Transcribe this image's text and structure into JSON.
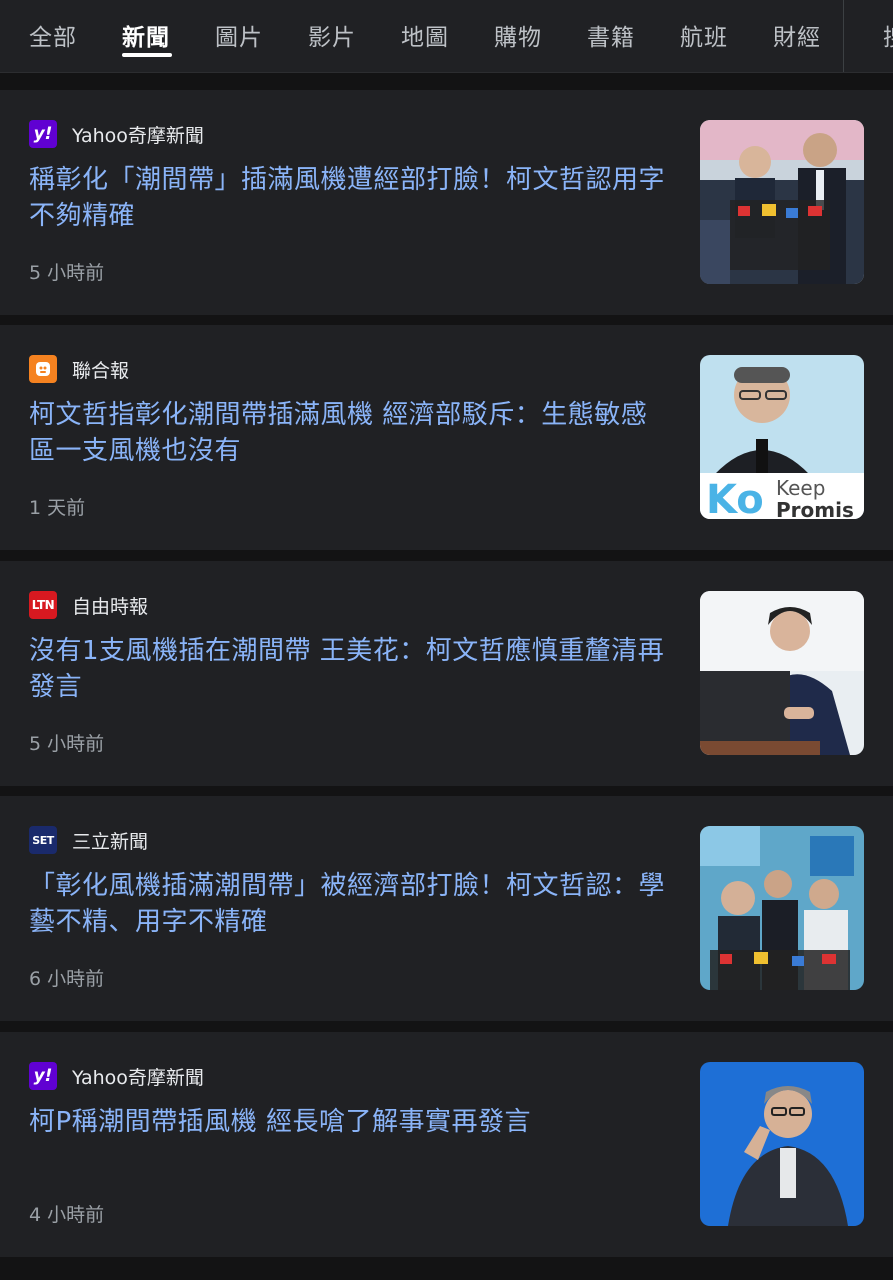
{
  "tabs": [
    "全部",
    "新聞",
    "圖片",
    "影片",
    "地圖",
    "購物",
    "書籍",
    "航班",
    "財經"
  ],
  "active_tab": "新聞",
  "more_tab_partial": "搜",
  "articles": [
    {
      "source": "Yahoo奇摩新聞",
      "source_icon": "yahoo-icon",
      "source_icon_color": "#6001d2",
      "headline": "稱彰化「潮間帶」插滿風機遭經部打臉！柯文哲認用字不夠精確",
      "time": "5 小時前",
      "thumbnail": "press-conference-photo"
    },
    {
      "source": "聯合報",
      "source_icon": "udn-icon",
      "source_icon_color": "#f58220",
      "headline": "柯文哲指彰化潮間帶插滿風機 經濟部駁斥：生態敏感區一支風機也沒有",
      "time": "1 天前",
      "thumbnail": "speaker-at-podium-photo",
      "thumbnail_text": [
        "Keep",
        "Promis"
      ]
    },
    {
      "source": "自由時報",
      "source_icon": "ltn-icon",
      "source_icon_color": "#d71920",
      "source_icon_text": "LTN",
      "headline": "沒有1支風機插在潮間帶 王美花：柯文哲應慎重釐清再發言",
      "time": "5 小時前",
      "thumbnail": "official-at-lectern-photo"
    },
    {
      "source": "三立新聞",
      "source_icon": "set-icon",
      "source_icon_color": "#1a2a6c",
      "source_icon_text": "SET",
      "headline": "「彰化風機插滿潮間帶」被經濟部打臉！柯文哲認：學藝不精、用字不精確",
      "time": "6 小時前",
      "thumbnail": "crowd-interview-photo"
    },
    {
      "source": "Yahoo奇摩新聞",
      "source_icon": "yahoo-icon",
      "source_icon_color": "#6001d2",
      "headline": "柯P稱潮間帶插風機 經長嗆了解事實再發言",
      "time": "4 小時前",
      "thumbnail": "speaker-gesturing-photo"
    }
  ]
}
